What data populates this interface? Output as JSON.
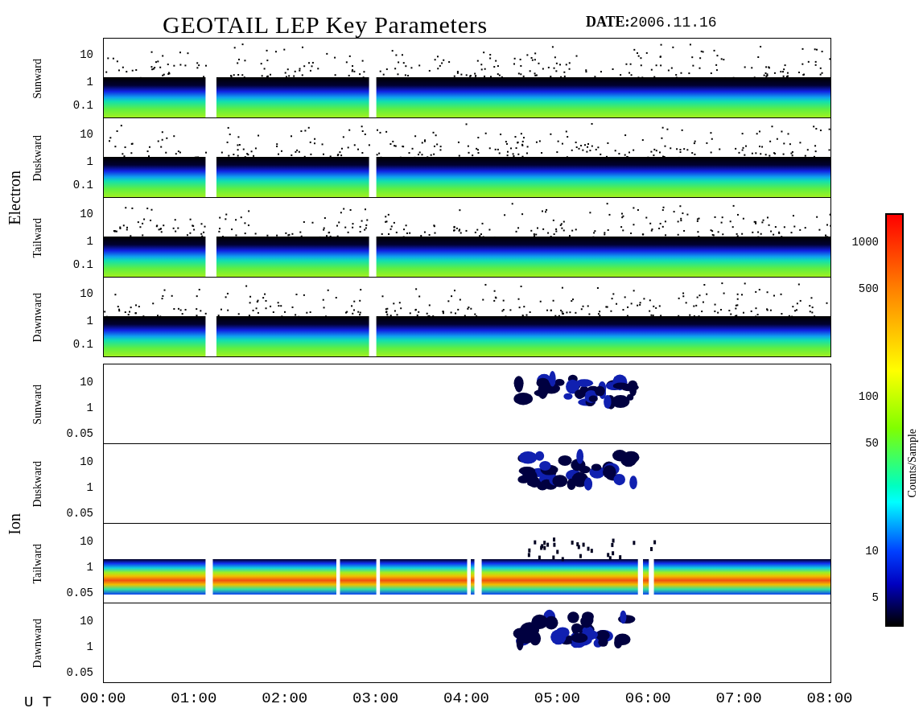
{
  "title": "GEOTAIL LEP Key Parameters",
  "date": {
    "label": "DATE:",
    "value": "2006.11.16"
  },
  "groups": [
    {
      "name": "Electron",
      "panels": [
        {
          "label": "Sunward",
          "kind": "electron",
          "yticks": [
            "10",
            "1",
            "0.1"
          ]
        },
        {
          "label": "Duskward",
          "kind": "electron",
          "yticks": [
            "10",
            "1",
            "0.1"
          ]
        },
        {
          "label": "Tailward",
          "kind": "electron",
          "yticks": [
            "10",
            "1",
            "0.1"
          ]
        },
        {
          "label": "Dawnward",
          "kind": "electron",
          "yticks": [
            "10",
            "1",
            "0.1"
          ]
        }
      ]
    },
    {
      "name": "Ion",
      "panels": [
        {
          "label": "Sunward",
          "kind": "sparse",
          "yticks": [
            "10",
            "1",
            "0.05"
          ]
        },
        {
          "label": "Duskward",
          "kind": "sparse",
          "yticks": [
            "10",
            "1",
            "0.05"
          ]
        },
        {
          "label": "Tailward",
          "kind": "band",
          "yticks": [
            "10",
            "1",
            "0.05"
          ]
        },
        {
          "label": "Dawnward",
          "kind": "sparse",
          "yticks": [
            "10",
            "1",
            "0.05"
          ]
        }
      ]
    }
  ],
  "x_axis": {
    "label": "U T",
    "ticks": [
      "00:00",
      "01:00",
      "02:00",
      "03:00",
      "04:00",
      "05:00",
      "06:00",
      "07:00",
      "08:00"
    ]
  },
  "colorbar": {
    "title": "Counts/Sample",
    "ticks": [
      "1000",
      "500",
      "100",
      "50",
      "10",
      "5"
    ]
  }
}
